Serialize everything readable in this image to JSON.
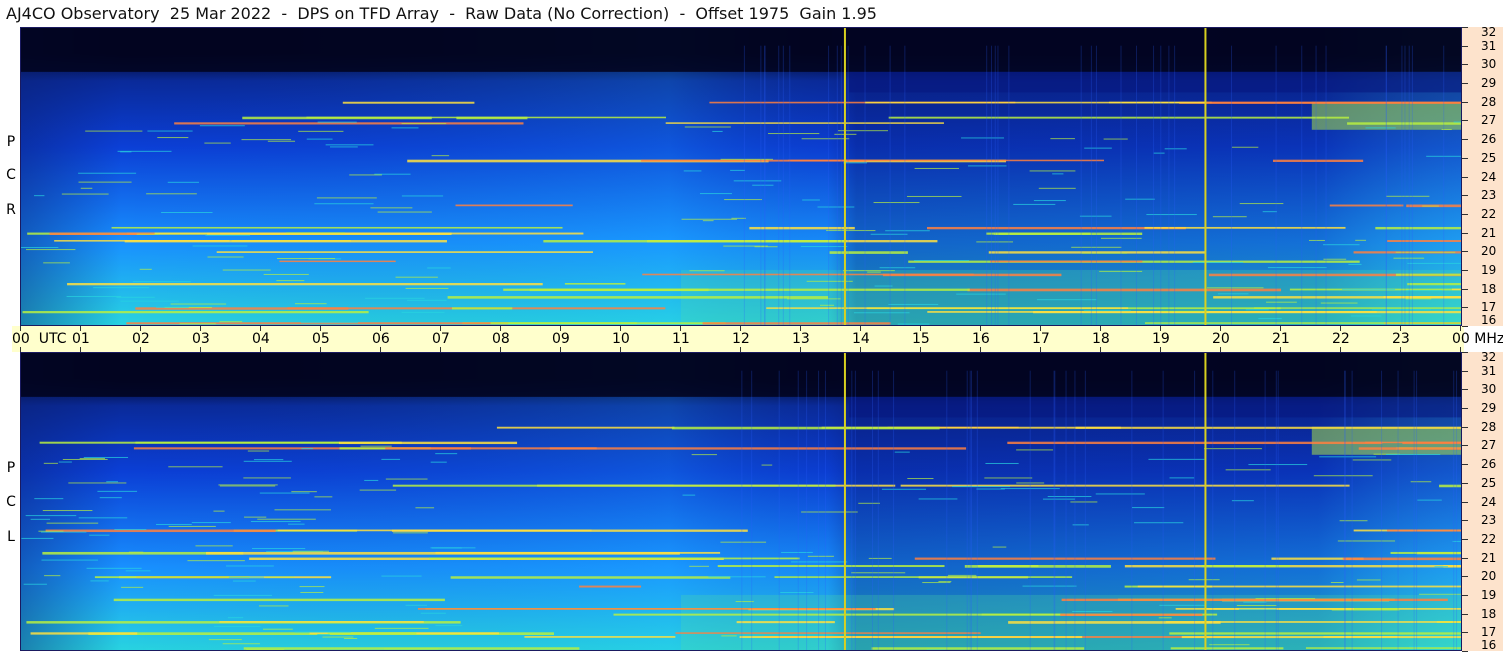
{
  "title": "AJ4CO Observatory  25 Mar 2022  -  DPS on TFD Array  -  Raw Data (No Correction)  -  Offset 1975  Gain 1.95",
  "panels": {
    "top": {
      "side_label": [
        "R",
        "C",
        "P"
      ]
    },
    "bottom": {
      "side_label": [
        "L",
        "C",
        "P"
      ]
    }
  },
  "time_axis": {
    "labels": [
      "00  UTC",
      "01",
      "02",
      "03",
      "04",
      "05",
      "06",
      "07",
      "08",
      "09",
      "10",
      "11",
      "12",
      "13",
      "14",
      "15",
      "16",
      "17",
      "18",
      "19",
      "20",
      "21",
      "22",
      "23",
      "00 MHz"
    ]
  },
  "freq_axis": {
    "labels": [
      "32",
      "31",
      "30",
      "29",
      "28",
      "27",
      "26",
      "25",
      "24",
      "23",
      "22",
      "21",
      "20",
      "19",
      "18",
      "17",
      "16"
    ]
  },
  "colors": {
    "background_dark": "#020420",
    "low": "#0b3fd6",
    "mid": "#1890ff",
    "high": "#28d4e0",
    "hot": "#b8f040",
    "peak": "#ffe040",
    "marker_line": "#d8d020",
    "axis_band": "#ffffcc",
    "freq_band": "#fde3cc"
  },
  "chart_data": {
    "type": "heatmap",
    "title": "AJ4CO Observatory  25 Mar 2022  -  DPS on TFD Array  -  Raw Data (No Correction)  -  Offset 1975  Gain 1.95",
    "x_range_utc_hours": [
      0,
      24
    ],
    "y_range_mhz": [
      16,
      32
    ],
    "panels": [
      "RCP",
      "LCP"
    ],
    "marker_lines_utc_hours": [
      13.73,
      19.73
    ],
    "interference_bands_mhz": [
      16.2,
      16.8,
      17.0,
      17.6,
      18.0,
      18.3,
      18.8,
      19.5,
      20.0,
      20.6,
      21.0,
      21.3,
      22.5,
      24.9,
      26.9,
      27.2,
      28.0
    ]
  }
}
